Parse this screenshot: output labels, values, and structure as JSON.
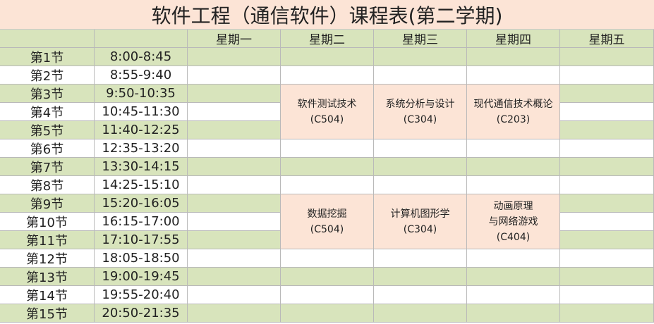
{
  "title": "软件工程（通信软件）课程表(第二学期)",
  "header": {
    "blank1": "",
    "blank2": "",
    "days": [
      "星期一",
      "星期二",
      "星期三",
      "星期四",
      "星期五"
    ]
  },
  "periods": [
    {
      "label": "第1节",
      "time": "8:00-8:45"
    },
    {
      "label": "第2节",
      "time": "8:55-9:40"
    },
    {
      "label": "第3节",
      "time": "9:50-10:35"
    },
    {
      "label": "第4节",
      "time": "10:45-11:30"
    },
    {
      "label": "第5节",
      "time": "11:40-12:25"
    },
    {
      "label": "第6节",
      "time": "12:35-13:20"
    },
    {
      "label": "第7节",
      "time": "13:30-14:15"
    },
    {
      "label": "第8节",
      "time": "14:25-15:10"
    },
    {
      "label": "第9节",
      "time": "15:20-16:05"
    },
    {
      "label": "第10节",
      "time": "16:15-17:00"
    },
    {
      "label": "第11节",
      "time": "17:10-17:55"
    },
    {
      "label": "第12节",
      "time": "18:05-18:50"
    },
    {
      "label": "第13节",
      "time": "19:00-19:45"
    },
    {
      "label": "第14节",
      "time": "19:55-20:40"
    },
    {
      "label": "第15节",
      "time": "20:50-21:35"
    }
  ],
  "courses": [
    {
      "day": 2,
      "start": 3,
      "end": 5,
      "lines": [
        "软件测试技术",
        "(C504)"
      ]
    },
    {
      "day": 3,
      "start": 3,
      "end": 5,
      "lines": [
        "系统分析与设计",
        "(C304)"
      ]
    },
    {
      "day": 4,
      "start": 3,
      "end": 5,
      "lines": [
        "现代通信技术概论",
        "(C203)"
      ]
    },
    {
      "day": 2,
      "start": 9,
      "end": 11,
      "lines": [
        "数据挖掘",
        "(C504)"
      ]
    },
    {
      "day": 3,
      "start": 9,
      "end": 11,
      "lines": [
        "计算机图形学",
        "(C304)"
      ]
    },
    {
      "day": 4,
      "start": 9,
      "end": 11,
      "lines": [
        "动画原理",
        "与网络游戏",
        "(C404)"
      ]
    }
  ],
  "colors": {
    "green_row": "#d8e4bc",
    "white_row": "#ffffff",
    "course_cell": "#fce4d6",
    "title_bg": "#fce4d6"
  }
}
